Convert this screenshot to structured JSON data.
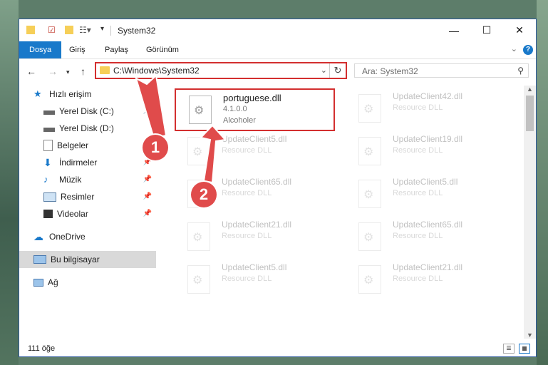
{
  "window": {
    "title": "System32"
  },
  "ribbon": {
    "tabs": [
      "Dosya",
      "Giriş",
      "Paylaş",
      "Görünüm"
    ],
    "help": "?"
  },
  "address": {
    "path": "C:\\Windows\\System32"
  },
  "search": {
    "placeholder": "Ara: System32"
  },
  "nav": {
    "items": [
      {
        "label": "Hızlı erişim"
      },
      {
        "label": "Yerel Disk (C:)"
      },
      {
        "label": "Yerel Disk (D:)"
      },
      {
        "label": "Belgeler"
      },
      {
        "label": "İndirmeler"
      },
      {
        "label": "Müzik"
      },
      {
        "label": "Resimler"
      },
      {
        "label": "Videolar"
      },
      {
        "label": "OneDrive"
      },
      {
        "label": "Bu bilgisayar"
      },
      {
        "label": "Ağ"
      }
    ]
  },
  "files": [
    {
      "name": "portuguese.dll",
      "version": "4.1.0.0",
      "desc": "Alcoholer"
    },
    {
      "name": "UpdateClient42.dll",
      "desc": "Resource DLL"
    },
    {
      "name": "UpdateClient5.dll",
      "desc": "Resource DLL"
    },
    {
      "name": "UpdateClient19.dll",
      "desc": "Resource DLL"
    },
    {
      "name": "UpdateClient65.dll",
      "desc": "Resource DLL"
    },
    {
      "name": "UpdateClient5.dll",
      "desc": "Resource DLL"
    },
    {
      "name": "UpdateClient21.dll",
      "desc": "Resource DLL"
    },
    {
      "name": "UpdateClient65.dll",
      "desc": "Resource DLL"
    },
    {
      "name": "UpdateClient5.dll",
      "desc": "Resource DLL"
    },
    {
      "name": "UpdateClient21.dll",
      "desc": "Resource DLL"
    }
  ],
  "status": {
    "count": "111 öğe"
  },
  "annotations": {
    "one": "1",
    "two": "2"
  },
  "colors": {
    "accent": "#1979ca",
    "highlight": "#d32f2f",
    "badge": "#e04b4b"
  }
}
